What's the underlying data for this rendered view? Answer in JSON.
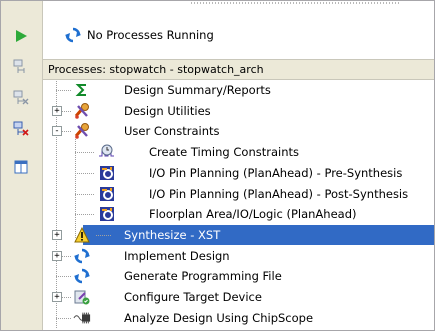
{
  "status": {
    "text": "No Processes Running",
    "icon": "refresh-icon"
  },
  "header": {
    "label": "Processes: stopwatch - stopwatch_arch"
  },
  "toolbar": {
    "items": [
      {
        "name": "run-button",
        "icon": "play-icon"
      },
      {
        "name": "process-properties-button",
        "icon": "process-props-icon"
      },
      {
        "name": "rerun-all-button",
        "icon": "rerun-icon"
      },
      {
        "name": "stop-button",
        "icon": "stop-process-icon"
      },
      {
        "name": "view-design-summary-button",
        "icon": "window-icon"
      }
    ]
  },
  "tree": {
    "items": [
      {
        "label": "Design Summary/Reports",
        "icon": "sigma-icon",
        "expander": ""
      },
      {
        "label": "Design Utilities",
        "icon": "tools-icon",
        "expander": "+"
      },
      {
        "label": "User Constraints",
        "icon": "tools-icon",
        "expander": "-"
      },
      {
        "label": "Create Timing Constraints",
        "icon": "clock-icon",
        "expander": ""
      },
      {
        "label": "I/O Pin Planning (PlanAhead) - Pre-Synthesis",
        "icon": "planahead-icon",
        "expander": ""
      },
      {
        "label": "I/O Pin Planning (PlanAhead) - Post-Synthesis",
        "icon": "planahead-icon",
        "expander": ""
      },
      {
        "label": "Floorplan Area/IO/Logic (PlanAhead)",
        "icon": "planahead-icon",
        "expander": ""
      },
      {
        "label": "Synthesize - XST",
        "icon": "warning-icon",
        "expander": "+"
      },
      {
        "label": "Implement Design",
        "icon": "refresh-icon",
        "expander": "+"
      },
      {
        "label": "Generate Programming File",
        "icon": "refresh-icon",
        "expander": ""
      },
      {
        "label": "Configure Target Device",
        "icon": "device-icon",
        "expander": "+"
      },
      {
        "label": "Analyze Design Using ChipScope",
        "icon": "chipscope-icon",
        "expander": ""
      }
    ]
  },
  "colors": {
    "selection": "#316ac5",
    "toolbar": "#ece9d8",
    "play": "#2eaa3a"
  }
}
